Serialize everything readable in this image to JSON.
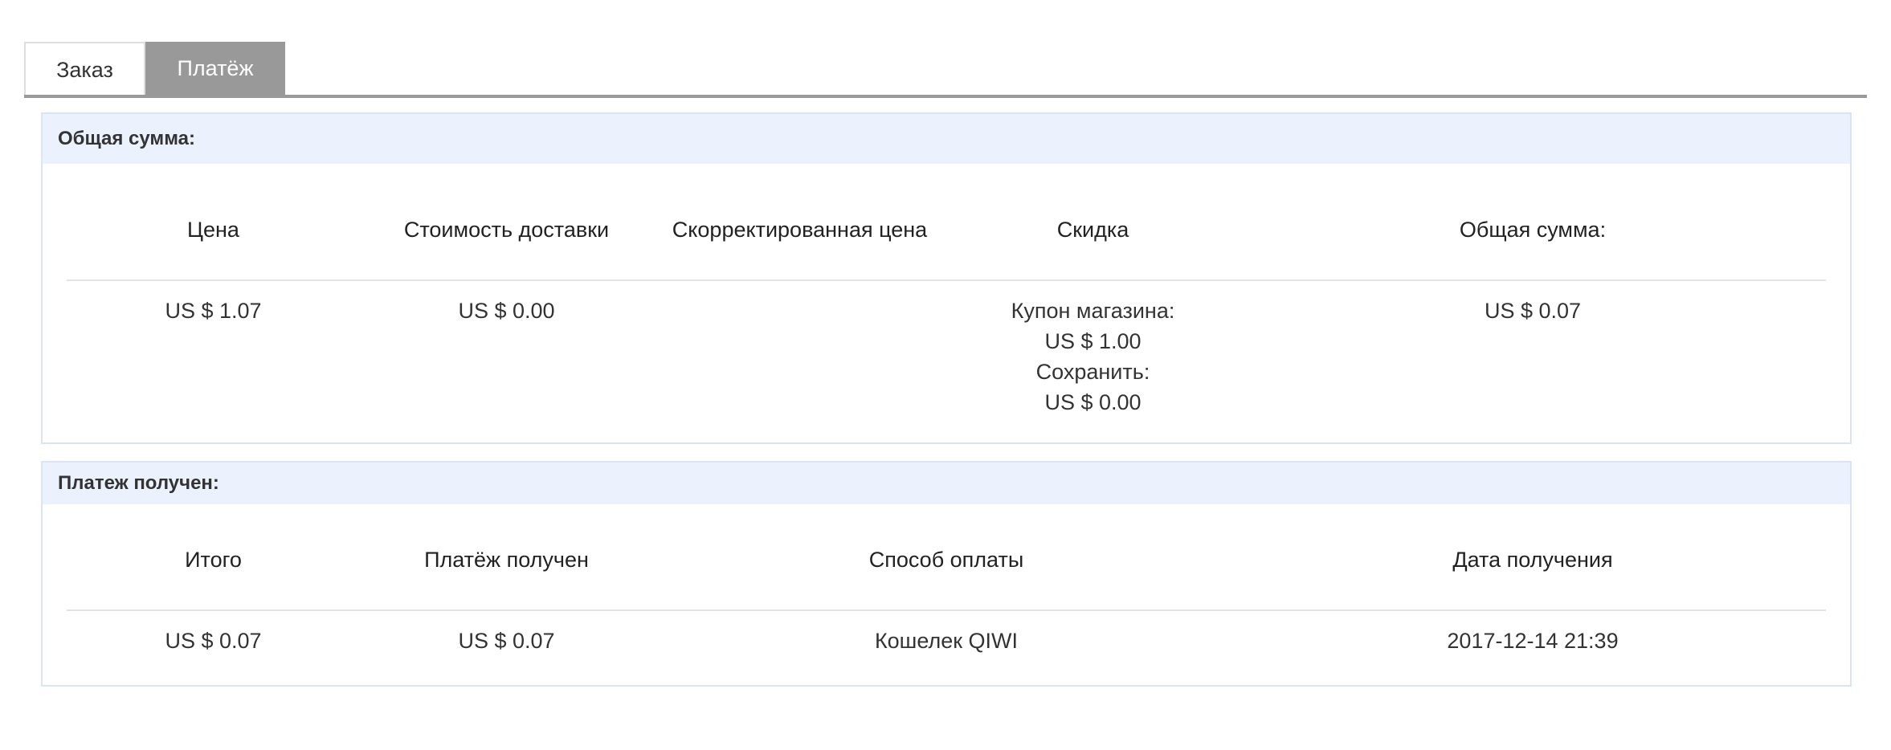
{
  "tabs": [
    {
      "label": "Заказ"
    },
    {
      "label": "Платёж"
    }
  ],
  "total": {
    "header": "Общая сумма:",
    "columns": [
      "Цена",
      "Стоимость доставки",
      "Скорректированная цена",
      "Скидка",
      "Общая сумма:"
    ],
    "row": {
      "price": "US $ 1.07",
      "shipping": "US $ 0.00",
      "adjusted": "",
      "discount": {
        "coupon_label": "Купон магазина:",
        "coupon_value": "US $ 1.00",
        "save_label": "Сохранить:",
        "save_value": "US $ 0.00"
      },
      "total": "US $ 0.07"
    }
  },
  "payment": {
    "header": "Платеж получен:",
    "columns": [
      "Итого",
      "Платёж получен",
      "Способ оплаты",
      "Дата получения"
    ],
    "row": {
      "subtotal": "US $ 0.07",
      "received": "US $ 0.07",
      "method": "Кошелек QIWI",
      "date": "2017-12-14 21:39"
    }
  }
}
